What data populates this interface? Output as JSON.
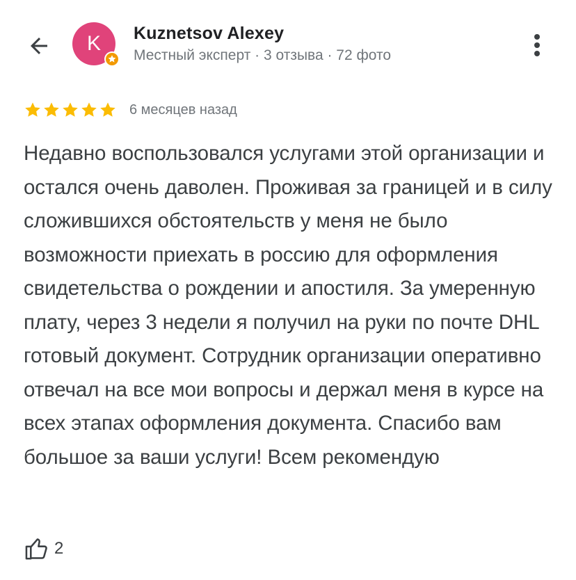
{
  "header": {
    "back_icon": "arrow-left-icon",
    "avatar_letter": "K",
    "avatar_color": "#e0437a",
    "badge_icon": "local-guide-badge-icon",
    "user_name": "Kuznetsov Alexey",
    "user_meta": "Местный эксперт · 3 отзыва · 72 фото",
    "more_icon": "more-vertical-icon"
  },
  "review": {
    "rating": 5,
    "rating_max": 5,
    "star_color": "#fbbc04",
    "date": "6 месяцев назад",
    "text": "Недавно воспользовался услугами этой организации и остался очень даволен. Проживая за границей и в силу сложившихся обстоятельств у меня не было возможности приехать в россию для оформления свидетельства о рождении и апостиля. За умеренную плату, через 3 недели я получил на руки по почте DHL готовый документ. Сотрудник организации оперативно отвечал на все мои вопросы и держал меня в курсе на всех этапах оформления документа. Спасибо вам большое за ваши услуги! Всем рекомендую",
    "like_icon": "thumbs-up-icon",
    "likes": "2"
  }
}
